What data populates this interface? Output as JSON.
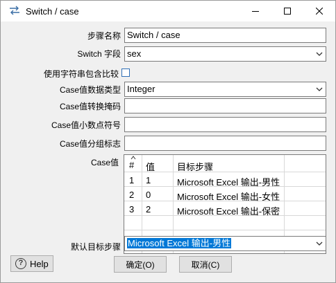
{
  "window": {
    "title": "Switch / case",
    "app_icon": "switch-arrows-icon",
    "controls": {
      "minimize": "minimize-icon",
      "maximize": "maximize-icon",
      "close": "close-icon"
    }
  },
  "form": {
    "step_name_label": "步骤名称",
    "step_name_value": "Switch / case",
    "switch_field_label": "Switch 字段",
    "switch_field_value": "sex",
    "use_contains_label": "使用字符串包含比较",
    "use_contains_checked": false,
    "case_type_label": "Case值数据类型",
    "case_type_value": "Integer",
    "conversion_mask_label": "Case值转换掩码",
    "conversion_mask_value": "",
    "decimal_symbol_label": "Case值小数点符号",
    "decimal_symbol_value": "",
    "grouping_symbol_label": "Case值分组标志",
    "grouping_symbol_value": "",
    "case_values_label": "Case值",
    "default_target_label": "默认目标步骤",
    "default_target_value": "Microsoft Excel 输出-男性"
  },
  "table": {
    "sort_icon": "sort-caret-icon",
    "columns": [
      "#",
      "值",
      "目标步骤"
    ],
    "rows": [
      {
        "num": "1",
        "value": "1",
        "target": "Microsoft Excel 输出-男性"
      },
      {
        "num": "2",
        "value": "0",
        "target": "Microsoft Excel 输出-女性"
      },
      {
        "num": "3",
        "value": "2",
        "target": "Microsoft Excel 输出-保密"
      }
    ]
  },
  "buttons": {
    "help_label": "Help",
    "help_icon": "question-circle-icon",
    "ok_label": "确定(O)",
    "cancel_label": "取消(C)"
  },
  "colors": {
    "selection": "#0078d7",
    "checkbox_border": "#2f6fb6"
  }
}
